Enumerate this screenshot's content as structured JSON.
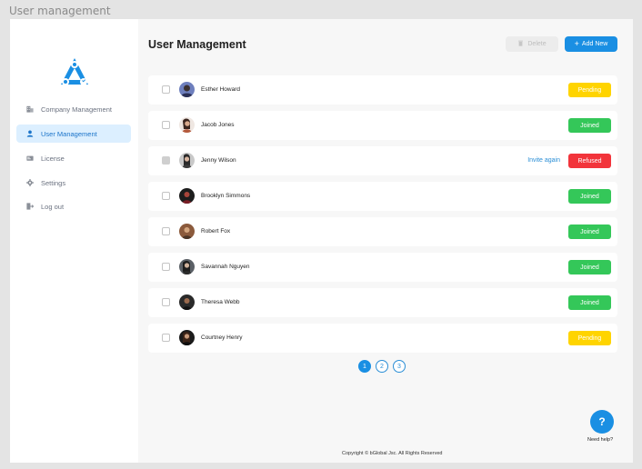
{
  "window_title": "User management",
  "colors": {
    "accent": "#1a8fe3",
    "pending": "#ffd400",
    "joined": "#34c759",
    "refused": "#f2343b",
    "active_nav_bg": "#dcefff"
  },
  "sidebar": {
    "items": [
      {
        "label": "Company Management",
        "icon": "building-icon",
        "active": false
      },
      {
        "label": "User Management",
        "icon": "user-icon",
        "active": true
      },
      {
        "label": "License",
        "icon": "license-card-icon",
        "active": false
      },
      {
        "label": "Settings",
        "icon": "gear-icon",
        "active": false
      },
      {
        "label": "Log out",
        "icon": "logout-icon",
        "active": false
      }
    ]
  },
  "header": {
    "title": "User Management",
    "delete_label": "Delete",
    "add_label": "Add New"
  },
  "users": [
    {
      "name": "Esther Howard",
      "status": "Pending"
    },
    {
      "name": "Jacob Jones",
      "status": "Joined"
    },
    {
      "name": "Jenny Wilson",
      "status": "Refused",
      "invite": "Invite again"
    },
    {
      "name": "Brooklyn Simmons",
      "status": "Joined"
    },
    {
      "name": "Robert Fox",
      "status": "Joined"
    },
    {
      "name": "Savannah Nguyen",
      "status": "Joined"
    },
    {
      "name": "Theresa Webb",
      "status": "Joined"
    },
    {
      "name": "Courtney Henry",
      "status": "Pending"
    }
  ],
  "pagination": {
    "pages": [
      "1",
      "2",
      "3"
    ],
    "current": "1"
  },
  "help": {
    "icon_text": "?",
    "label": "Need help?"
  },
  "footer": {
    "copyright": "Copyright © bGlobal Jsc. All Rights Reserved"
  }
}
